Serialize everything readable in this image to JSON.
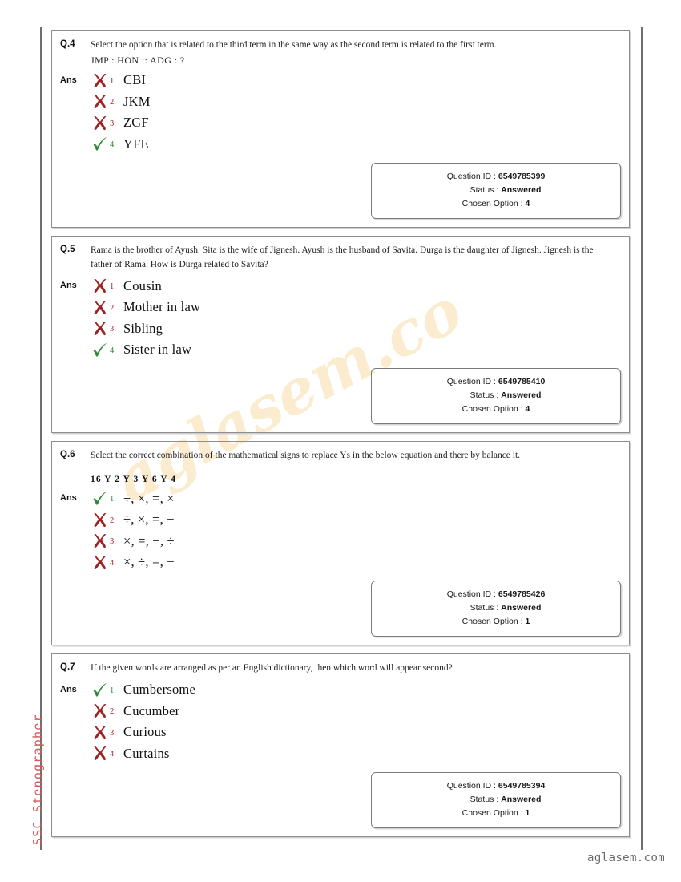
{
  "page": {
    "exam_title": "SSC Stenographer",
    "watermark_diagonal": "aglasem.co",
    "watermark_footer": "aglasem.com",
    "answer_label": "Ans",
    "meta_labels": {
      "question_id": "Question ID :",
      "status": "Status :",
      "chosen_option": "Chosen Option :"
    }
  },
  "questions": [
    {
      "number": "Q.4",
      "text": "Select the option that is related to the third term in the same way as the second term is related to the first term.",
      "subtext": "JMP : HON :: ADG : ?",
      "equation": "",
      "options": [
        {
          "num": "1.",
          "text": "CBI",
          "mark": "cross-icon"
        },
        {
          "num": "2.",
          "text": "JKM",
          "mark": "cross-icon"
        },
        {
          "num": "3.",
          "text": "ZGF",
          "mark": "cross-icon"
        },
        {
          "num": "4.",
          "text": "YFE",
          "mark": "check-icon"
        }
      ],
      "meta": {
        "question_id": "6549785399",
        "status": "Answered",
        "chosen_option": "4"
      }
    },
    {
      "number": "Q.5",
      "text": "Rama is the brother of Ayush. Sita is the wife of Jignesh. Ayush is the husband of Savita. Durga is the daughter of Jignesh. Jignesh is the father of Rama. How is Durga related to Savita?",
      "subtext": "",
      "equation": "",
      "options": [
        {
          "num": "1.",
          "text": "Cousin",
          "mark": "cross-icon"
        },
        {
          "num": "2.",
          "text": "Mother in law",
          "mark": "cross-icon"
        },
        {
          "num": "3.",
          "text": "Sibling",
          "mark": "cross-icon"
        },
        {
          "num": "4.",
          "text": "Sister in law",
          "mark": "check-icon"
        }
      ],
      "meta": {
        "question_id": "6549785410",
        "status": "Answered",
        "chosen_option": "4"
      }
    },
    {
      "number": "Q.6",
      "text": "Select the correct combination of the mathematical signs to replace Ys in the below equation and there by balance it.",
      "subtext": "",
      "equation": "16 Y 2 Y 3 Y 6 Y 4",
      "options": [
        {
          "num": "1.",
          "text": "÷, ×, =, ×",
          "mark": "check-icon"
        },
        {
          "num": "2.",
          "text": "÷, ×, =, −",
          "mark": "cross-icon"
        },
        {
          "num": "3.",
          "text": "×, =, −, ÷",
          "mark": "cross-icon"
        },
        {
          "num": "4.",
          "text": "×, ÷, =, −",
          "mark": "cross-icon"
        }
      ],
      "meta": {
        "question_id": "6549785426",
        "status": "Answered",
        "chosen_option": "1"
      }
    },
    {
      "number": "Q.7",
      "text": "If the given words are arranged as per an English dictionary, then which word will appear second?",
      "subtext": "",
      "equation": "",
      "options": [
        {
          "num": "1.",
          "text": "Cumbersome",
          "mark": "check-icon"
        },
        {
          "num": "2.",
          "text": "Cucumber",
          "mark": "cross-icon"
        },
        {
          "num": "3.",
          "text": "Curious",
          "mark": "cross-icon"
        },
        {
          "num": "4.",
          "text": "Curtains",
          "mark": "cross-icon"
        }
      ],
      "meta": {
        "question_id": "6549785394",
        "status": "Answered",
        "chosen_option": "1"
      }
    }
  ],
  "colors": {
    "cross": "#9e2222",
    "check": "#2f8a36",
    "exam_title": "#d2595c",
    "watermark": "#fbeccf"
  }
}
